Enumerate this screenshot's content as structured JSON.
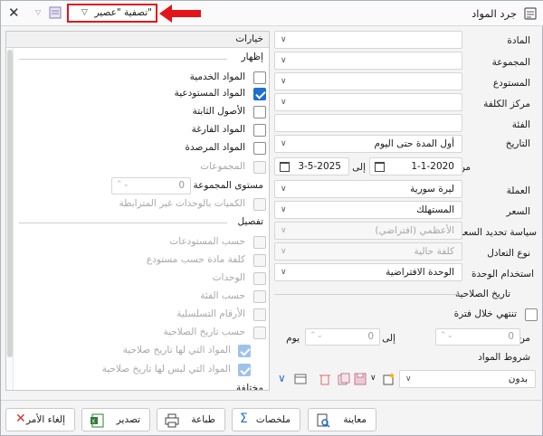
{
  "window": {
    "title": "جرد المواد",
    "filter_label": "تصفية \"عصير\""
  },
  "form": {
    "material_label": "المادة",
    "group_label": "المجموعة",
    "warehouse_label": "المستودع",
    "cost_center_label": "مركز الكلفة",
    "category_label": "الفئة",
    "date_label": "التاريخ",
    "date_value": "أول المدة حتى اليوم",
    "from_label": "من",
    "to_label": "إلى",
    "date_from": "1-1-2020",
    "date_to": "3-5-2025",
    "currency_label": "العملة",
    "currency_value": "ليرة سورية",
    "price_label": "السعر",
    "price_value": "المستهلك",
    "price_policy_label": "سياسة تحديد السعر",
    "price_policy_value": "الأعظمي (افتراضي)",
    "equiv_type_label": "نوع التعادل",
    "equiv_type_value": "كلفة حالية",
    "unit_usage_label": "استخدام الوحدة",
    "unit_usage_value": "الوحدة الافتراضية",
    "expiry_section": "تاريخ الصلاحية",
    "expires_within": "تنتهي خلال فترة",
    "exp_from_label": "من",
    "exp_from_value": "0",
    "exp_to_label": "إلى",
    "exp_to_value": "0",
    "day_label": "يوم",
    "conditions_label": "شروط المواد",
    "conditions_value": "بدون"
  },
  "options": {
    "title": "خيارات",
    "show_section": "إظهار",
    "show_items": [
      {
        "label": "المواد الخدمية",
        "checked": false
      },
      {
        "label": "المواد المستودعية",
        "checked": true
      },
      {
        "label": "الأصول الثابتة",
        "checked": false
      },
      {
        "label": "المواد الفارغة",
        "checked": false
      },
      {
        "label": "المواد المرصدة",
        "checked": false
      },
      {
        "label": "المجموعات",
        "checked": false,
        "disabled": true
      }
    ],
    "group_level_label": "مستوى المجموعة",
    "group_level_value": "0",
    "unrelated_units": "الكميات بالوحدات غير المترابطة",
    "detail_section": "تفصيل",
    "detail_items": [
      {
        "label": "حسب المستودعات"
      },
      {
        "label": "كلفة مادة حسب مستودع"
      },
      {
        "label": "الوحدات"
      },
      {
        "label": "حسب الفئة"
      },
      {
        "label": "الأرقام التسلسلية"
      },
      {
        "label": "حسب تاريخ الصلاحية"
      },
      {
        "label": "المواد التي لها تاريخ صلاحية"
      },
      {
        "label": "المواد التي ليس لها تاريخ صلاحية"
      }
    ],
    "misc_section": "مختلفة"
  },
  "buttons": {
    "preview": "معاينة",
    "summaries": "ملخصات",
    "print": "طباعة",
    "export": "تصدير",
    "cancel": "إلغاء الأمر"
  },
  "colors": {
    "accent": "#1f6fd1",
    "highlight": "#e4141b"
  }
}
